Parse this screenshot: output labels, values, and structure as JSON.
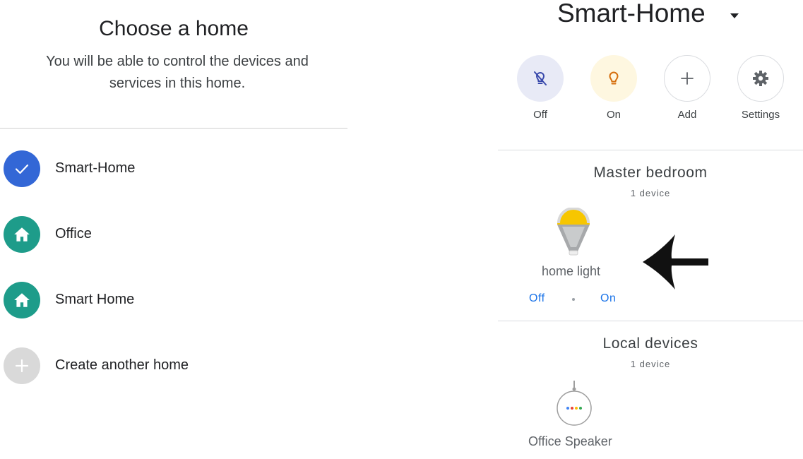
{
  "chooser": {
    "title": "Choose a home",
    "subtitle": "You will be able to control the devices and services in this home.",
    "homes": [
      {
        "label": "Smart-Home",
        "icon": "check-icon",
        "color": "#3367d6",
        "selected": true
      },
      {
        "label": "Office",
        "icon": "home-icon",
        "color": "#1e9c8a",
        "selected": false
      },
      {
        "label": "Smart Home",
        "icon": "home-icon",
        "color": "#1e9c8a",
        "selected": false
      },
      {
        "label": "Create another home",
        "icon": "plus-icon",
        "color": "#d9d9d9",
        "selected": false
      }
    ]
  },
  "home": {
    "title": "Smart-Home",
    "quick_actions": [
      {
        "label": "Off",
        "icon": "light-off-icon"
      },
      {
        "label": "On",
        "icon": "lightbulb-icon"
      },
      {
        "label": "Add",
        "icon": "plus-icon"
      },
      {
        "label": "Settings",
        "icon": "gear-icon"
      }
    ],
    "rooms": [
      {
        "name": "Master bedroom",
        "count": "1 device",
        "device": {
          "label": "home light",
          "icon": "smart-bulb-icon",
          "off_label": "Off",
          "on_label": "On"
        }
      },
      {
        "name": "Local devices",
        "count": "1 device",
        "device": {
          "label": "Office Speaker",
          "icon": "smart-speaker-icon"
        }
      }
    ]
  },
  "colors": {
    "accent": "#1a73e8",
    "selected": "#3367d6",
    "home_icon": "#1e9c8a",
    "bulb_on": "#f7c600"
  }
}
